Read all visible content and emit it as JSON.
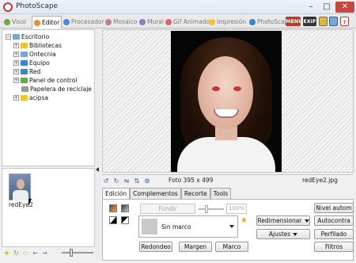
{
  "window": {
    "title": "PhotoScape",
    "min": "–",
    "max": "□",
    "close": "✕"
  },
  "tabs": [
    {
      "label": "Visor",
      "active": false,
      "color": "#6aa84f"
    },
    {
      "label": "Editor",
      "active": true,
      "color": "#e69138"
    },
    {
      "label": "Procesador",
      "active": false,
      "color": "#4a86e8"
    },
    {
      "label": "Mosaico",
      "active": false,
      "color": "#c27ba0"
    },
    {
      "label": "Mural",
      "active": false,
      "color": "#8e7cc3"
    },
    {
      "label": "Gif Animado",
      "active": false,
      "color": "#e06666"
    },
    {
      "label": "Impresión",
      "active": false,
      "color": "#f1c232"
    },
    {
      "label": "PhotoScape",
      "active": false,
      "color": "#3d85c6"
    }
  ],
  "tab_buttons": {
    "menu": "MENU",
    "exif": "EXIF"
  },
  "tree": {
    "root": "Escritorio",
    "items": [
      {
        "label": "Bibliotecas",
        "color": "#f1c232",
        "expandable": true
      },
      {
        "label": "Ontecnia",
        "color": "#6fa8dc",
        "expandable": true
      },
      {
        "label": "Equipo",
        "color": "#3d85c6",
        "expandable": true
      },
      {
        "label": "Red",
        "color": "#3d85c6",
        "expandable": true
      },
      {
        "label": "Panel de control",
        "color": "#6aa84f",
        "expandable": true
      },
      {
        "label": "Papelera de reciclaje",
        "color": "#999999",
        "expandable": false
      },
      {
        "label": "acipsa",
        "color": "#f1c232",
        "expandable": true
      }
    ]
  },
  "thumbnails": [
    {
      "label": "redEye2"
    }
  ],
  "photo_info": "Foto 395 x 499",
  "filename": "redEye2.jpg",
  "editor_tabs": [
    {
      "label": "Edición",
      "active": true
    },
    {
      "label": "Complementos",
      "active": false
    },
    {
      "label": "Recorte",
      "active": false
    },
    {
      "label": "Tools",
      "active": false
    }
  ],
  "edit": {
    "fundir": "Fundir",
    "opacity": "100%",
    "frame": "Sin marco",
    "buttons": {
      "redondeo": "Redondeo",
      "margen": "Margen",
      "marco": "Marco",
      "redimensionar": "Redimensionar",
      "ajustes": "Ajustes",
      "nivel_auto": "Nivel autom",
      "autocontraste": "Autocontra",
      "perfilado": "Perfilado",
      "filtros": "Filtros"
    }
  }
}
